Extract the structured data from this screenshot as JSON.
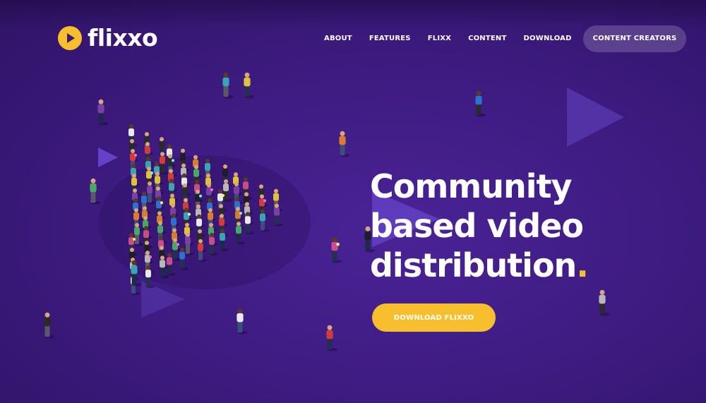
{
  "brand": {
    "name": "flixxo",
    "logo_icon": "play-circle-icon",
    "accent": "#f7bf2e",
    "background": "#3d1b80"
  },
  "nav": {
    "items": [
      {
        "label": "ABOUT"
      },
      {
        "label": "FEATURES"
      },
      {
        "label": "FLIXX"
      },
      {
        "label": "CONTENT"
      },
      {
        "label": "DOWNLOAD"
      }
    ],
    "cta_label": "CONTENT CREATORS"
  },
  "hero": {
    "line1": "Community",
    "line2": "based video",
    "line3": "distribution",
    "period": ".",
    "button_label": "DOWNLOAD FLIXXO"
  }
}
